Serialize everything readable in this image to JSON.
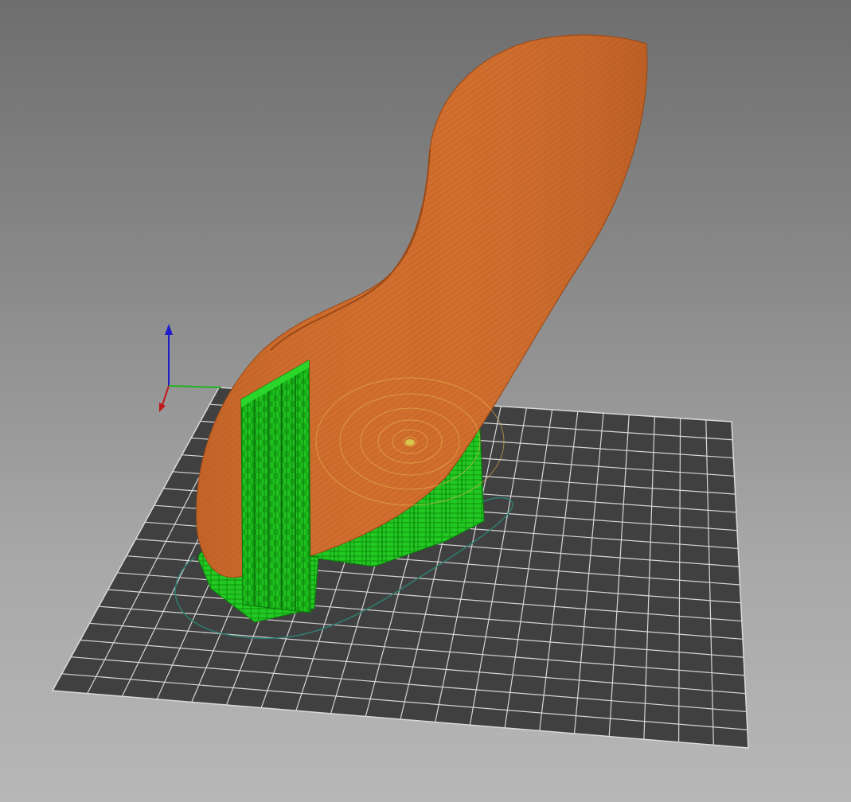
{
  "viewport": {
    "view": "3d-preview",
    "background_top": "#6e6e6e",
    "background_bottom": "#b7b7b7"
  },
  "bed": {
    "grid": true,
    "fill_color": "#404040",
    "grid_color": "#d9d9d9",
    "rows": 18,
    "cols": 20
  },
  "axes": {
    "x_color": "#c0181a",
    "y_color": "#1fb31f",
    "z_color": "#1c1cc8"
  },
  "model": {
    "shape": "curved shell",
    "color_main": "#cf6a2a",
    "color_edge": "#e0b25a",
    "inner_color": "#9b2a24"
  },
  "supports": {
    "color": "#1fc21f",
    "dark_color": "#0d8a0d"
  },
  "skirt": {
    "color": "#2f7c6e"
  }
}
